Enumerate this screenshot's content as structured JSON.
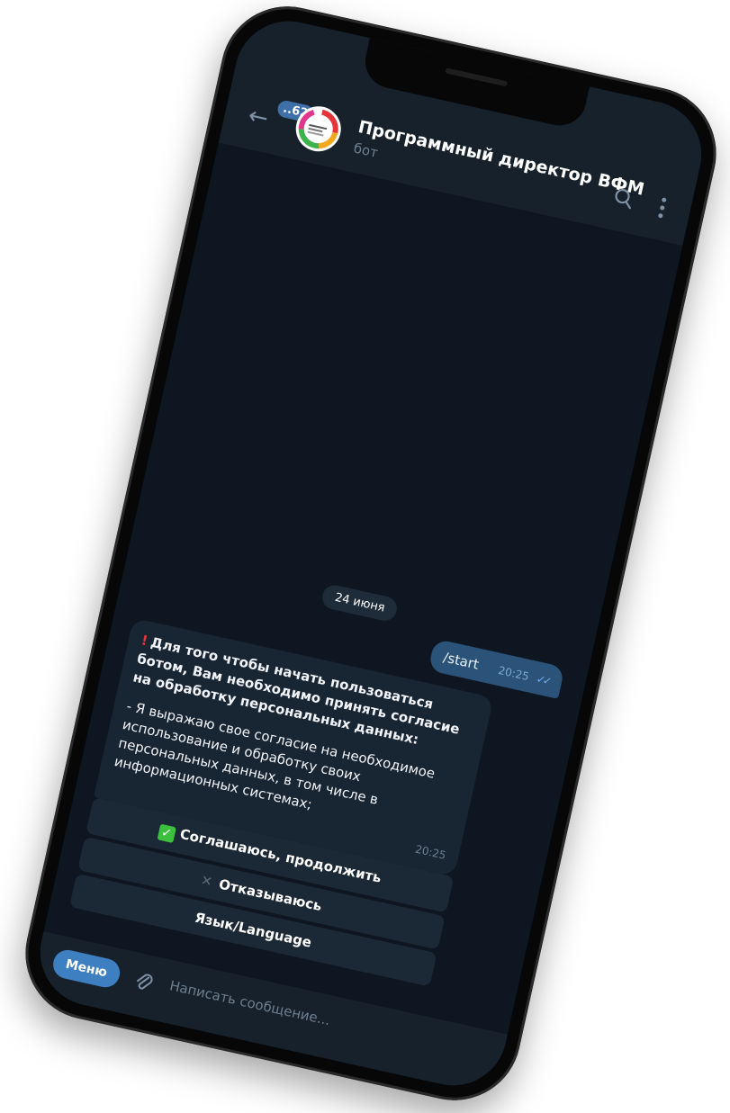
{
  "header": {
    "unread_count": "..62",
    "title": "Программный директор ВФМ",
    "subtitle": "бот"
  },
  "chat": {
    "date_separator": "24 июня",
    "outgoing": {
      "text": "/start",
      "time": "20:25"
    },
    "incoming": {
      "bold_text": "Для того чтобы начать пользоваться ботом, Вам необходимо принять согласие на обработку персональных данных:",
      "body_text": "- Я выражаю свое согласие на необходимое использование и обработку своих персональных данных, в том числе в информационных системах;",
      "time": "20:25"
    }
  },
  "keyboard": {
    "agree": "Соглашаюсь, продолжить",
    "decline": "Отказываюсь",
    "language": "Язык/Language"
  },
  "composer": {
    "menu_label": "Меню",
    "placeholder": "Написать сообщение..."
  },
  "colors": {
    "chat_bg": "#0e1621",
    "header_bg": "#17212b",
    "outgoing_bubble": "#2b5278",
    "incoming_bubble": "#182533",
    "accent": "#3e7fc1"
  }
}
